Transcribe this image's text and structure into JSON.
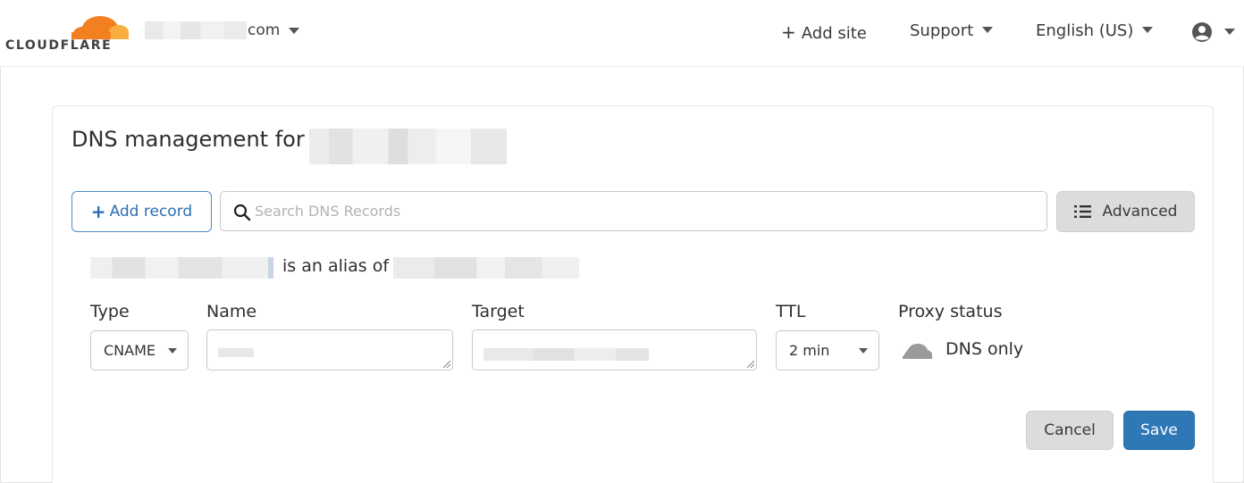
{
  "header": {
    "logo_text": "CLOUDFLARE",
    "site_suffix": "com",
    "add_site_label": "Add site",
    "support_label": "Support",
    "language_label": "English (US)"
  },
  "dns": {
    "title": "DNS management for",
    "add_record_label": "Add record",
    "search_placeholder": "Search DNS Records",
    "advanced_label": "Advanced",
    "alias_text": "is an alias of"
  },
  "form": {
    "type_label": "Type",
    "name_label": "Name",
    "target_label": "Target",
    "ttl_label": "TTL",
    "proxy_label": "Proxy status",
    "type_value": "CNAME",
    "ttl_value": "2 min",
    "proxy_value": "DNS only",
    "cancel_label": "Cancel",
    "save_label": "Save"
  },
  "colors": {
    "brand_orange": "#f38020",
    "primary_blue": "#2f78b6",
    "outline_blue": "#4f8cc6"
  },
  "icons": {
    "logo": "cloudflare-cloud-icon",
    "add": "plus-icon",
    "search": "search-icon",
    "advanced": "list-icon",
    "user": "user-icon",
    "proxy": "cloud-dns-only-icon"
  }
}
